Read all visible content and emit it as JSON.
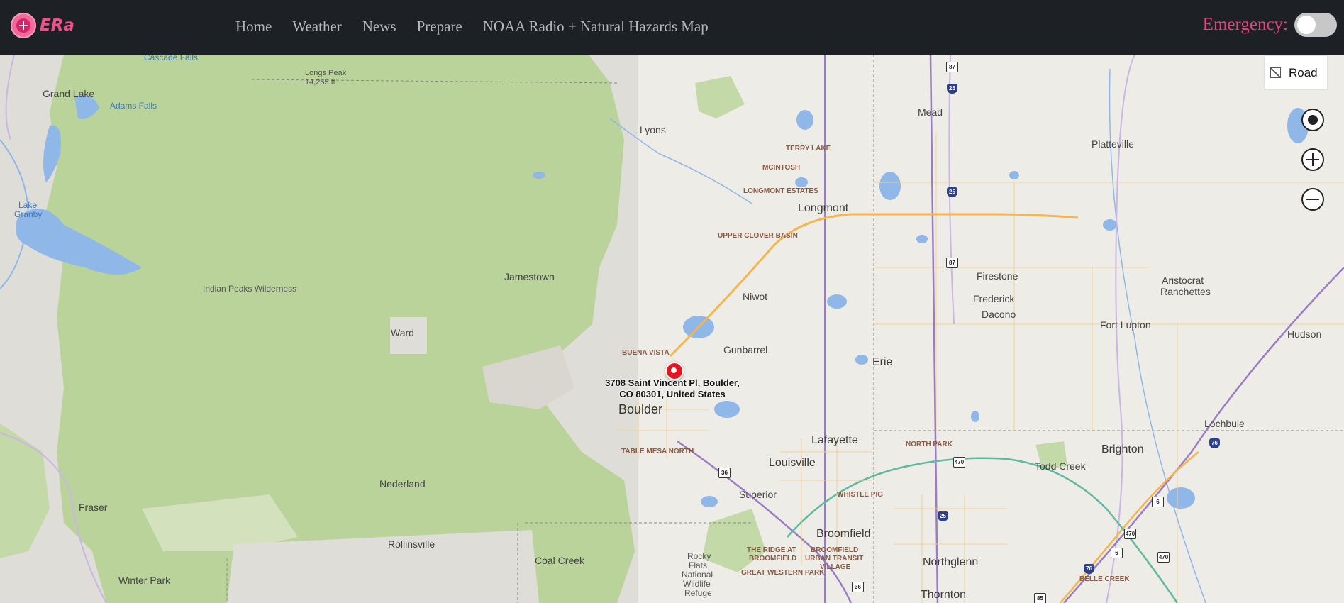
{
  "app": {
    "logo_text": "ERa"
  },
  "nav": {
    "items": [
      "Home",
      "Weather",
      "News",
      "Prepare",
      "NOAA Radio + Natural Hazards Map"
    ]
  },
  "emergency": {
    "label": "Emergency:",
    "enabled": false
  },
  "map": {
    "layer_label": "Road",
    "marker_address_line1": "3708 Saint Vincent Pl, Boulder,",
    "marker_address_line2": "CO 80301, United States",
    "labels": {
      "cascade_falls": "Cascade Falls",
      "longs_peak": "Longs Peak",
      "longs_peak_elev": "14,255 ft",
      "grand_lake": "Grand Lake",
      "adams_falls": "Adams Falls",
      "lake_granby_1": "Lake",
      "lake_granby_2": "Granby",
      "lyons": "Lyons",
      "mead": "Mead",
      "terry_lake": "TERRY LAKE",
      "mcintosh": "MCINTOSH",
      "platteville": "Platteville",
      "longmont_estates": "LONGMONT ESTATES",
      "longmont": "Longmont",
      "upper_clover_basin": "UPPER CLOVER BASIN",
      "jamestown": "Jamestown",
      "indian_peaks": "Indian Peaks Wilderness",
      "firestone": "Firestone",
      "aristocrat_1": "Aristocrat",
      "aristocrat_2": "Ranchettes",
      "niwot": "Niwot",
      "frederick": "Frederick",
      "dacono": "Dacono",
      "fort_lupton": "Fort Lupton",
      "ward": "Ward",
      "hudson": "Hudson",
      "buena_vista": "BUENA VISTA",
      "gunbarrel": "Gunbarrel",
      "erie": "Erie",
      "boulder": "Boulder",
      "lochbuie": "Lochbuie",
      "lafayette": "Lafayette",
      "north_park": "NORTH PARK",
      "table_mesa": "TABLE MESA NORTH",
      "brighton": "Brighton",
      "louisville": "Louisville",
      "todd_creek": "Todd Creek",
      "nederland": "Nederland",
      "superior": "Superior",
      "whistle_pig": "WHISTLE PIG",
      "fraser": "Fraser",
      "broomfield": "Broomfield",
      "rollinsville": "Rollinsville",
      "ridge_1": "THE RIDGE AT",
      "ridge_2": "BROOMFIELD",
      "bf_village_1": "BROOMFIELD",
      "bf_village_2": "URBAN TRANSIT",
      "bf_village_3": "VILLAGE",
      "coal_creek": "Coal Creek",
      "rocky_flats_1": "Rocky",
      "rocky_flats_2": "Flats",
      "rocky_flats_3": "National",
      "rocky_flats_4": "Wildlife",
      "rocky_flats_5": "Refuge",
      "northglenn": "Northglenn",
      "great_western": "GREAT WESTERN PARK",
      "winter_park": "Winter Park",
      "thornton": "Thornton",
      "belle_creek": "BELLE CREEK"
    },
    "shields": {
      "i25": "25",
      "us87": "87",
      "us36": "36",
      "e470": "470",
      "us6": "6",
      "i76": "76",
      "us85": "85"
    }
  },
  "colors": {
    "navbar": "#1d2125",
    "accent_pink": "#ec3f79",
    "forest_green": "#b9d39a",
    "land": "#eeece6",
    "water": "#8fb7e8",
    "highway_orange": "#f5b54a",
    "highway_purple": "#9b7cc4",
    "toll_teal": "#5fb8a0"
  }
}
